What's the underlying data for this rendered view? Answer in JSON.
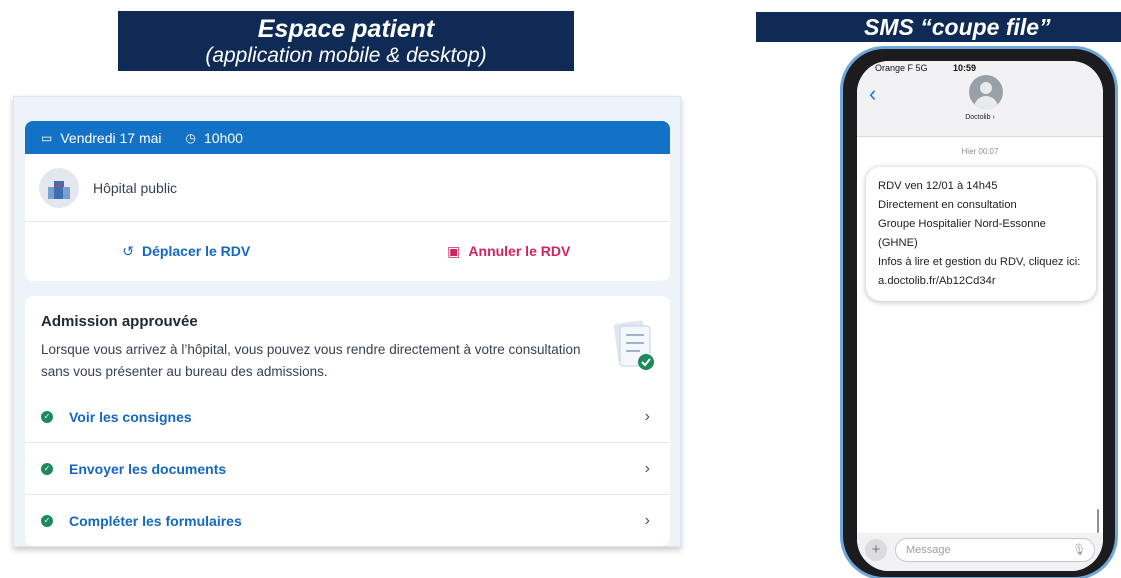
{
  "banners": {
    "left_title": "Espace patient",
    "left_subtitle": "(application mobile & desktop)",
    "right_title": "SMS “coupe file”"
  },
  "appointment": {
    "date_icon": "calendar-icon",
    "date": "Vendredi 17 mai",
    "time_icon": "clock-icon",
    "time": "10h00",
    "hospital": "Hôpital public",
    "move_label": "Déplacer le RDV",
    "cancel_label": "Annuler le RDV"
  },
  "admission": {
    "title": "Admission approuvée",
    "text": "Lorsque vous arrivez à l’hôpital, vous pouvez vous rendre directement à votre consultation sans vous présenter au bureau des admissions.",
    "items": [
      {
        "label": "Voir les consignes"
      },
      {
        "label": "Envoyer les documents"
      },
      {
        "label": "Compléter les formulaires"
      }
    ]
  },
  "phone": {
    "carrier": "Orange F 5G",
    "time": "10:59",
    "contact": "Doctolib ›",
    "timestamp": "Hier 00:07",
    "message_lines": [
      "RDV ven 12/01 à 14h45",
      "Directement en consultation",
      "Groupe Hospitalier Nord-Essonne (GHNE)",
      "Infos à lire et gestion du RDV, cliquez ici:",
      "a.doctolib.fr/Ab12Cd34r"
    ],
    "input_placeholder": "Message"
  },
  "colors": {
    "banner_bg": "#0e2a55",
    "header_blue": "#1371c6",
    "link_blue": "#1467c2",
    "cancel_red": "#d1245c",
    "check_green": "#1c8a5a"
  }
}
